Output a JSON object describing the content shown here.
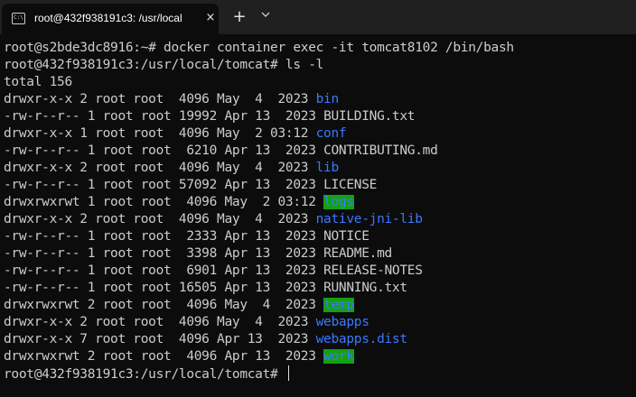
{
  "window": {
    "tab_title": "root@432f938191c3: /usr/local",
    "tab_icon": "terminal-icon",
    "close_icon": "×",
    "new_tab_icon": "+",
    "dropdown_icon": "⌄"
  },
  "terminal": {
    "commands": [
      {
        "prompt": "root@s2bde3dc8916:~# ",
        "command": "docker container exec -it tomcat8102 /bin/bash"
      },
      {
        "prompt": "root@432f938191c3:/usr/local/tomcat# ",
        "command": "ls -l"
      }
    ],
    "total": "total 156",
    "listing": [
      {
        "meta": "drwxr-x-x 2 root root  4096 May  4  2023 ",
        "name": "bin",
        "kind": "dir"
      },
      {
        "meta": "-rw-r--r-- 1 root root 19992 Apr 13  2023 ",
        "name": "BUILDING.txt",
        "kind": "file"
      },
      {
        "meta": "drwxr-x-x 1 root root  4096 May  2 03:12 ",
        "name": "conf",
        "kind": "dir"
      },
      {
        "meta": "-rw-r--r-- 1 root root  6210 Apr 13  2023 ",
        "name": "CONTRIBUTING.md",
        "kind": "file"
      },
      {
        "meta": "drwxr-x-x 2 root root  4096 May  4  2023 ",
        "name": "lib",
        "kind": "dir"
      },
      {
        "meta": "-rw-r--r-- 1 root root 57092 Apr 13  2023 ",
        "name": "LICENSE",
        "kind": "file"
      },
      {
        "meta": "drwxrwxrwt 1 root root  4096 May  2 03:12 ",
        "name": "logs",
        "kind": "sticky"
      },
      {
        "meta": "drwxr-x-x 2 root root  4096 May  4  2023 ",
        "name": "native-jni-lib",
        "kind": "dir"
      },
      {
        "meta": "-rw-r--r-- 1 root root  2333 Apr 13  2023 ",
        "name": "NOTICE",
        "kind": "file"
      },
      {
        "meta": "-rw-r--r-- 1 root root  3398 Apr 13  2023 ",
        "name": "README.md",
        "kind": "file"
      },
      {
        "meta": "-rw-r--r-- 1 root root  6901 Apr 13  2023 ",
        "name": "RELEASE-NOTES",
        "kind": "file"
      },
      {
        "meta": "-rw-r--r-- 1 root root 16505 Apr 13  2023 ",
        "name": "RUNNING.txt",
        "kind": "file"
      },
      {
        "meta": "drwxrwxrwt 2 root root  4096 May  4  2023 ",
        "name": "temp",
        "kind": "sticky"
      },
      {
        "meta": "drwxr-x-x 2 root root  4096 May  4  2023 ",
        "name": "webapps",
        "kind": "dir"
      },
      {
        "meta": "drwxr-x-x 7 root root  4096 Apr 13  2023 ",
        "name": "webapps.dist",
        "kind": "dir"
      },
      {
        "meta": "drwxrwxrwt 2 root root  4096 Apr 13  2023 ",
        "name": "work",
        "kind": "sticky"
      }
    ],
    "final_prompt": "root@432f938191c3:/usr/local/tomcat# "
  },
  "colors": {
    "background": "#0c0c0c",
    "text": "#cccccc",
    "directory": "#3b78ff",
    "sticky_bg": "#13a10e"
  }
}
